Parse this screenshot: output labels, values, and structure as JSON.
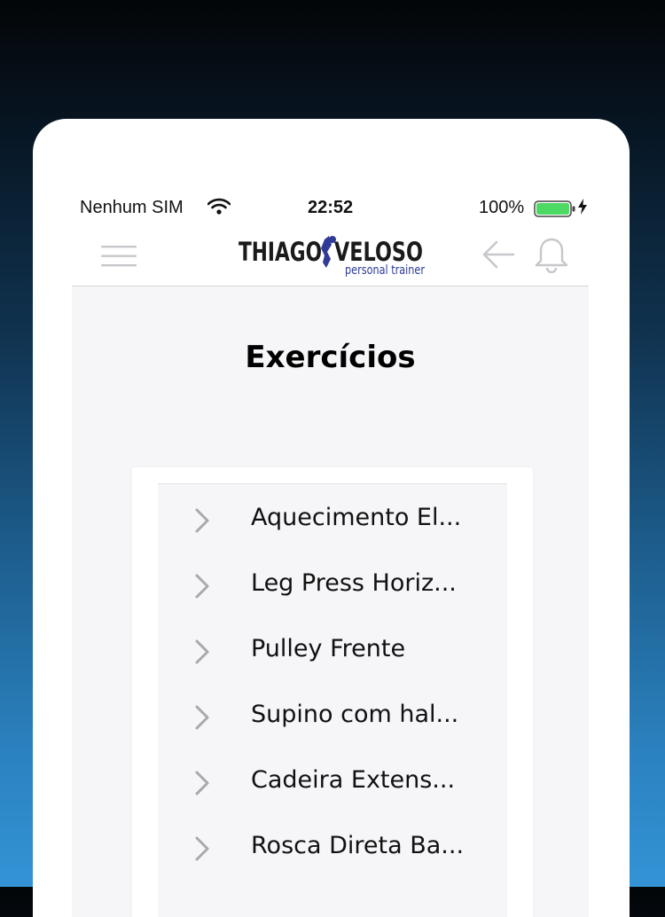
{
  "status_bar": {
    "carrier": "Nenhum SIM",
    "time": "22:52",
    "battery_percent": "100%",
    "battery_level": 1.0
  },
  "header": {
    "logo_name_left": "THIAGO",
    "logo_name_right": "VELOSO",
    "logo_tagline": "personal trainer",
    "icons": [
      "menu-icon",
      "back-arrow-icon",
      "bell-icon"
    ]
  },
  "page": {
    "title": "Exercícios"
  },
  "exercises": [
    "Aquecimento El...",
    "Leg Press Horiz...",
    "Pulley Frente",
    "Supino com hal...",
    "Cadeira Extens...",
    "Rosca Direta Ba..."
  ],
  "colors": {
    "battery": "#4cd964",
    "logo_dark": "#1a1a1a",
    "logo_blue": "#2f3b96",
    "icon_gray": "#c7c7cc",
    "content_bg": "#f6f6f9"
  }
}
